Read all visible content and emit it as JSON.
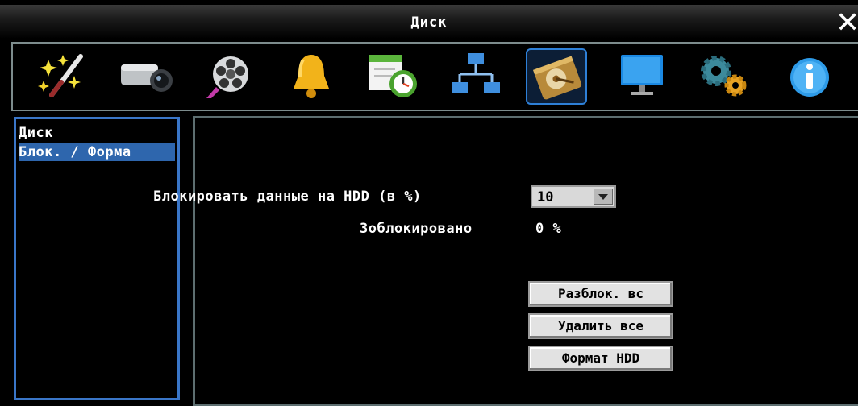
{
  "window": {
    "title": "Диск",
    "close_glyph": "✕"
  },
  "toolbar": {
    "icons": [
      {
        "name": "wizard-wand-icon"
      },
      {
        "name": "camera-icon"
      },
      {
        "name": "film-reel-icon"
      },
      {
        "name": "bell-icon"
      },
      {
        "name": "schedule-clock-icon"
      },
      {
        "name": "network-icon"
      },
      {
        "name": "hard-disk-icon",
        "active": true
      },
      {
        "name": "monitor-icon"
      },
      {
        "name": "gears-icon"
      },
      {
        "name": "info-icon"
      }
    ]
  },
  "sidebar": {
    "items": [
      {
        "label": "Диск",
        "selected": false
      },
      {
        "label": "Блок. / Форма",
        "selected": true
      }
    ]
  },
  "main": {
    "lock_label": "Блокировать данные на HDD (в %)",
    "lock_value": "10",
    "locked_label": "Зоблокировано",
    "locked_value": "0 %",
    "buttons": {
      "unlock_all": "Разблок. вс",
      "delete_all": "Удалить все",
      "format_hdd": "Формат HDD"
    }
  },
  "colors": {
    "accent_blue": "#3a76c8",
    "selection": "#2e66ad",
    "background": "#000000"
  }
}
